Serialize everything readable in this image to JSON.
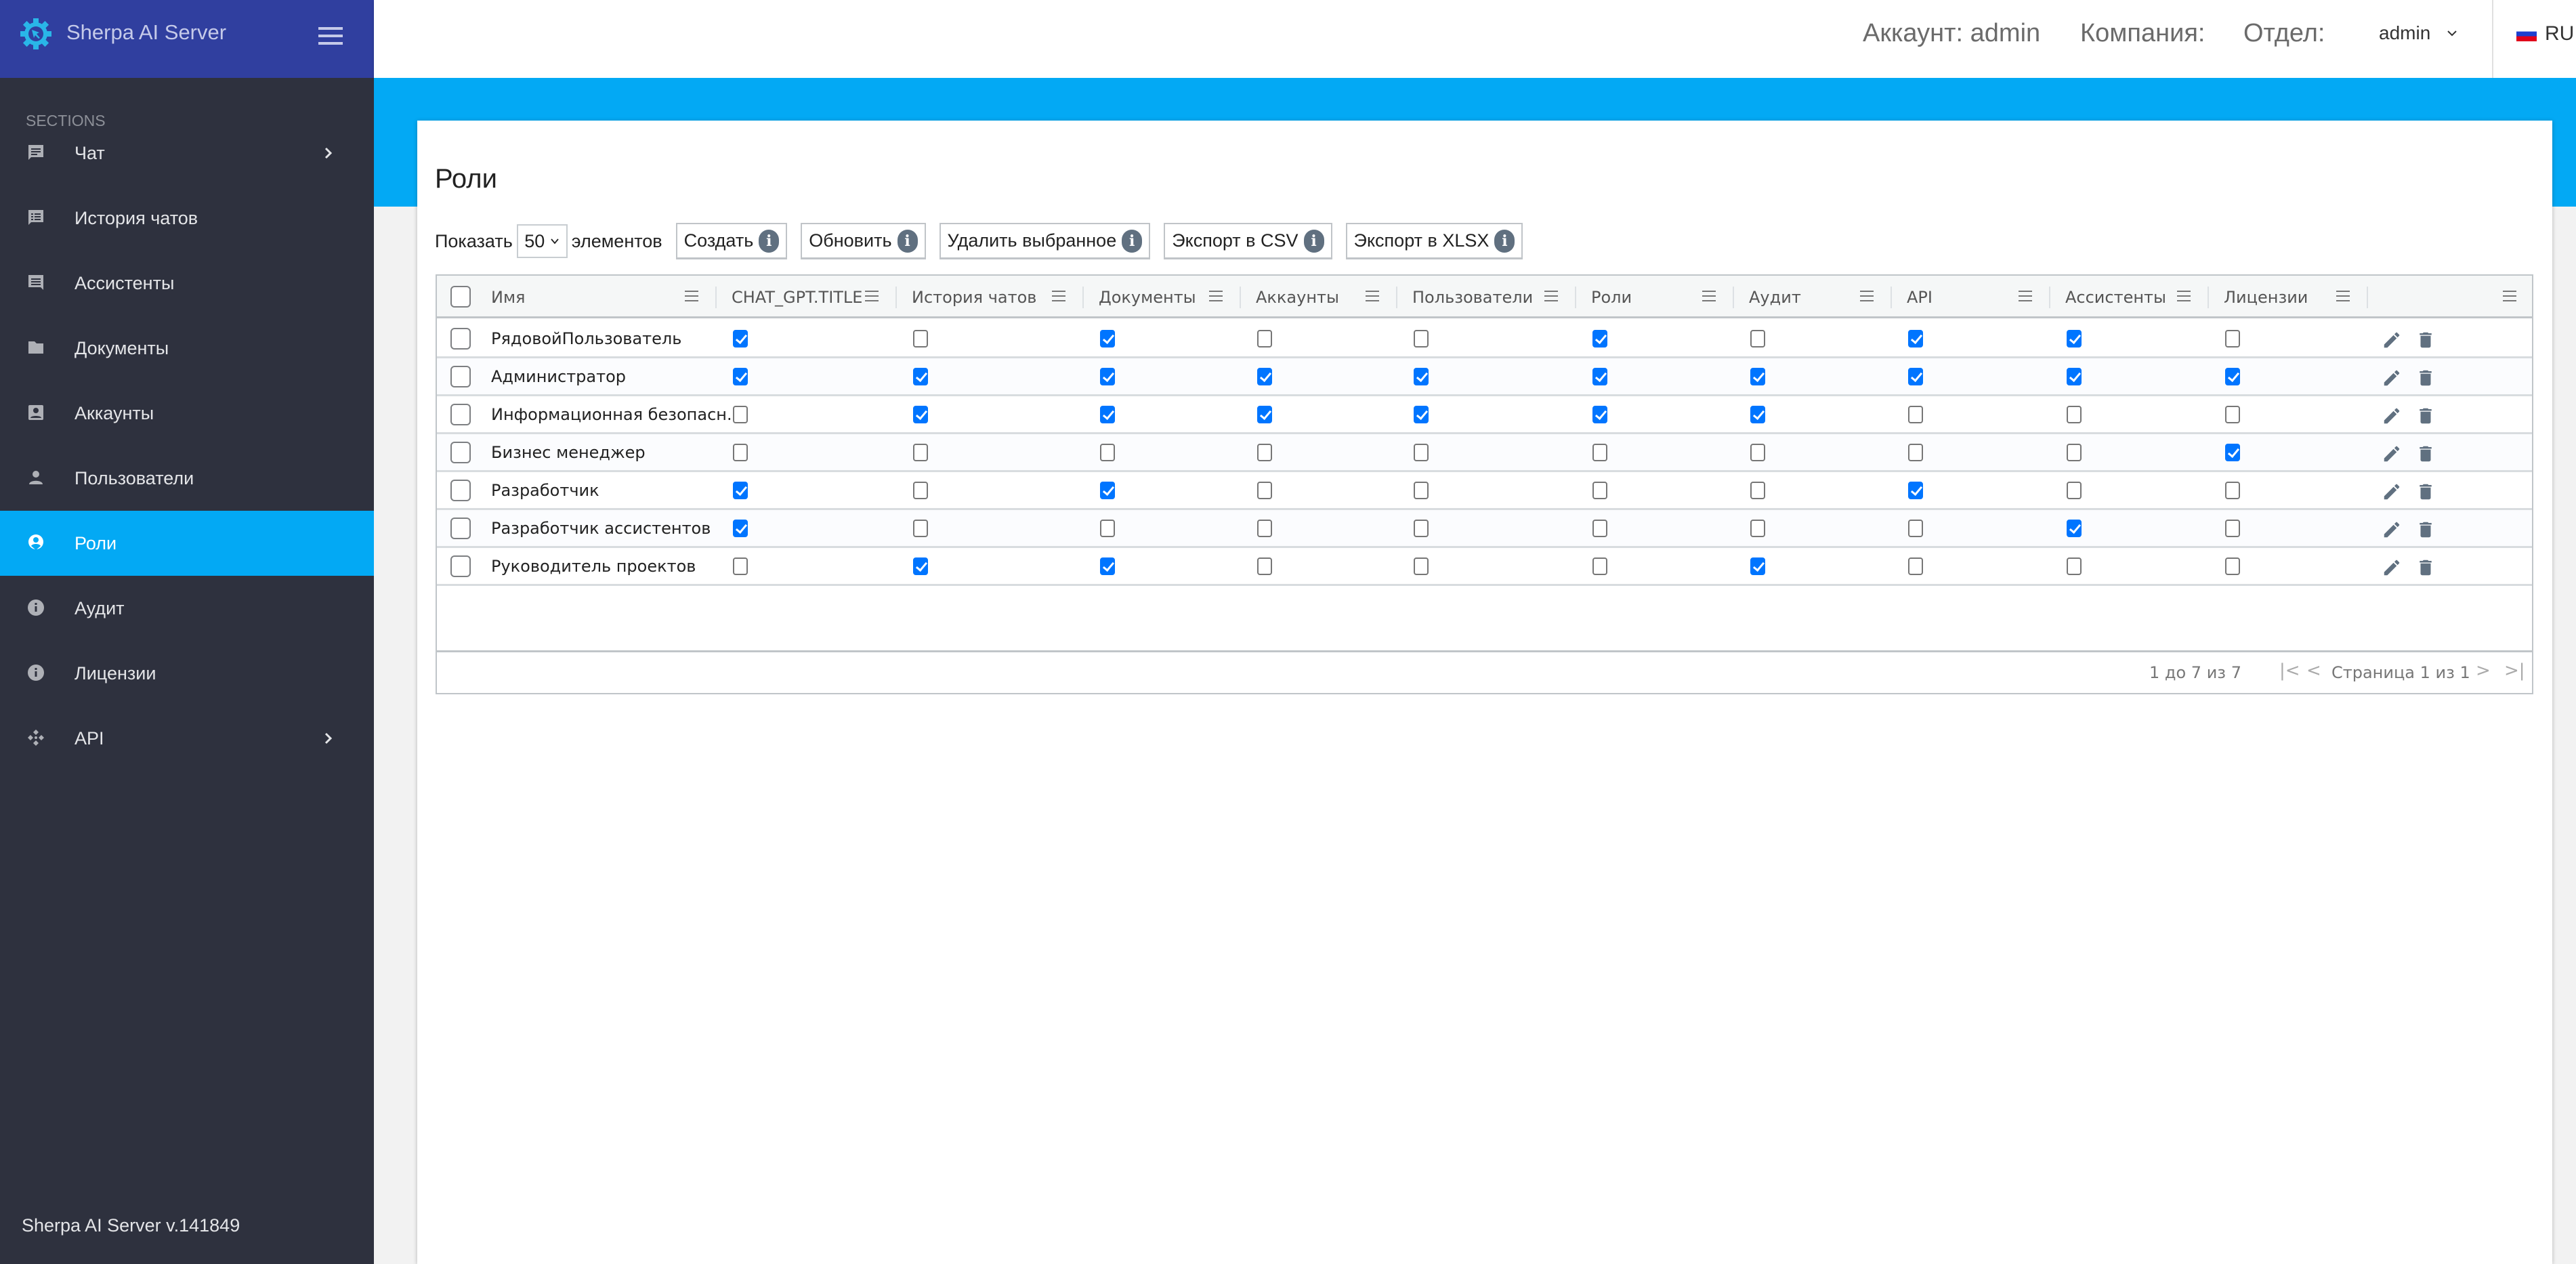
{
  "brand": {
    "title": "Sherpa AI Server",
    "logo_icon": "gear-cursor-icon"
  },
  "sidebar": {
    "section_label": "SECTIONS",
    "items": [
      {
        "label": "Чат",
        "icon": "chat-icon",
        "has_submenu": true,
        "active": false
      },
      {
        "label": "История чатов",
        "icon": "chat-list-icon",
        "has_submenu": false,
        "active": false
      },
      {
        "label": "Ассистенты",
        "icon": "assistant-message-icon",
        "has_submenu": false,
        "active": false
      },
      {
        "label": "Документы",
        "icon": "folder-icon",
        "has_submenu": false,
        "active": false
      },
      {
        "label": "Аккаунты",
        "icon": "account-box-icon",
        "has_submenu": false,
        "active": false
      },
      {
        "label": "Пользователи",
        "icon": "person-icon",
        "has_submenu": false,
        "active": false
      },
      {
        "label": "Роли",
        "icon": "account-circle-icon",
        "has_submenu": false,
        "active": true
      },
      {
        "label": "Аудит",
        "icon": "info-icon",
        "has_submenu": false,
        "active": false
      },
      {
        "label": "Лицензии",
        "icon": "info-icon",
        "has_submenu": false,
        "active": false
      },
      {
        "label": "API",
        "icon": "api-icon",
        "has_submenu": true,
        "active": false
      }
    ],
    "version": "Sherpa AI Server v.141849"
  },
  "topbar": {
    "account": "Аккаунт: admin",
    "company": "Компания:",
    "department": "Отдел:",
    "user": "admin",
    "language": "RU"
  },
  "colors": {
    "header": "#303f9f",
    "accent": "#03a9f4",
    "sidebar": "#2e313e",
    "checkbox": "#0075ff"
  },
  "page": {
    "title": "Роли",
    "toolbar": {
      "show_label": "Показать",
      "page_size": "50",
      "items_label": "элементов",
      "buttons": [
        "Создать",
        "Обновить",
        "Удалить выбранное",
        "Экспорт в CSV",
        "Экспорт в XLSX"
      ]
    },
    "table": {
      "columns": [
        "Имя",
        "CHAT_GPT.TITLE",
        "История чатов",
        "Документы",
        "Аккаунты",
        "Пользователи",
        "Роли",
        "Аудит",
        "API",
        "Ассистенты",
        "Лицензии",
        ""
      ],
      "rows": [
        {
          "name": "РядовойПользователь",
          "perms": [
            true,
            false,
            true,
            false,
            false,
            true,
            false,
            true,
            true,
            false
          ]
        },
        {
          "name": "Администратор",
          "perms": [
            true,
            true,
            true,
            true,
            true,
            true,
            true,
            true,
            true,
            true
          ]
        },
        {
          "name": "Информационная безопасн...",
          "perms": [
            false,
            true,
            true,
            true,
            true,
            true,
            true,
            false,
            false,
            false
          ]
        },
        {
          "name": "Бизнес менеджер",
          "perms": [
            false,
            false,
            false,
            false,
            false,
            false,
            false,
            false,
            false,
            true
          ]
        },
        {
          "name": "Разработчик",
          "perms": [
            true,
            false,
            true,
            false,
            false,
            false,
            false,
            true,
            false,
            false
          ]
        },
        {
          "name": "Разработчик ассистентов",
          "perms": [
            true,
            false,
            false,
            false,
            false,
            false,
            false,
            false,
            true,
            false
          ]
        },
        {
          "name": "Руководитель проектов",
          "perms": [
            false,
            true,
            true,
            false,
            false,
            false,
            true,
            false,
            false,
            false
          ]
        }
      ]
    },
    "pagination": {
      "summary": "1 до 7 из 7",
      "page_info": "Страница 1 из 1"
    }
  }
}
